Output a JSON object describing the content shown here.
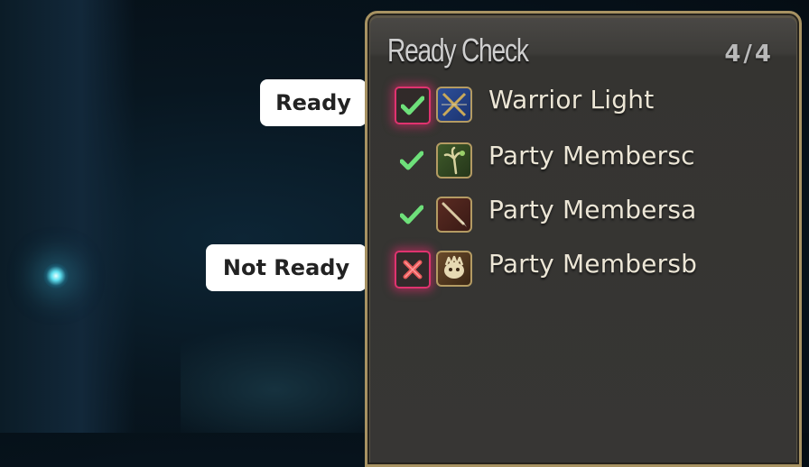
{
  "ready_check": {
    "title": "Ready Check",
    "count": "4/4",
    "members": [
      {
        "name": "Warrior Light",
        "status": "ready",
        "job_icon": "paladin-icon",
        "highlighted": true
      },
      {
        "name": "Party Membersc",
        "status": "ready",
        "job_icon": "conjurer-icon",
        "highlighted": false
      },
      {
        "name": "Party Membersa",
        "status": "ready",
        "job_icon": "lancer-icon",
        "highlighted": false
      },
      {
        "name": "Party Membersb",
        "status": "not-ready",
        "job_icon": "monk-icon",
        "highlighted": true
      }
    ]
  },
  "callouts": {
    "ready": "Ready",
    "not_ready": "Not Ready"
  },
  "colors": {
    "ready_check": "#6ee07a",
    "not_ready_x": "#e85a5a",
    "highlight": "#e0336f",
    "frame": "#a79262"
  }
}
